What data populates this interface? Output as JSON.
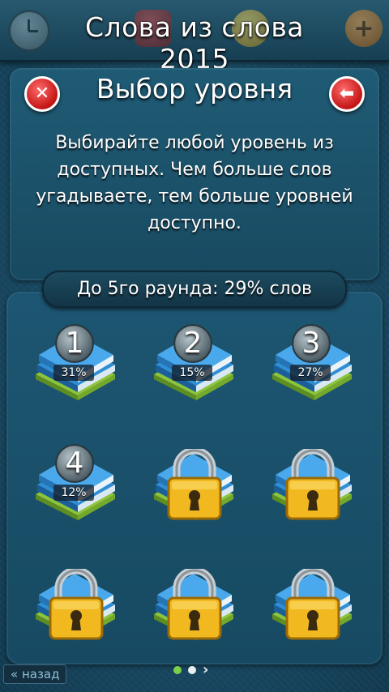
{
  "topbar": {
    "title": "Слова из слова 2015",
    "icons": [
      "clock-icon",
      "gift-icon",
      "coin-icon",
      "plus-icon"
    ]
  },
  "panel": {
    "title": "Выбор уровня",
    "description": "Выбирайте любой уровень из доступных. Чем больше слов угадываете, тем больше уровней доступно.",
    "close_icon": "close-icon",
    "back_icon": "back-arrow-icon"
  },
  "progress": {
    "text": "До 5го раунда: 29% слов"
  },
  "levels": [
    {
      "number": "1",
      "percent": "31%",
      "locked": false
    },
    {
      "number": "2",
      "percent": "15%",
      "locked": false
    },
    {
      "number": "3",
      "percent": "27%",
      "locked": false
    },
    {
      "number": "4",
      "percent": "12%",
      "locked": false
    },
    {
      "number": "",
      "percent": "",
      "locked": true
    },
    {
      "number": "",
      "percent": "",
      "locked": true
    },
    {
      "number": "",
      "percent": "",
      "locked": true
    },
    {
      "number": "",
      "percent": "",
      "locked": true
    },
    {
      "number": "",
      "percent": "",
      "locked": true
    }
  ],
  "pager": {
    "pages": 2,
    "current": 1,
    "next_icon": "chevron-right-icon"
  },
  "footer": {
    "back_label": "« назад"
  },
  "colors": {
    "background": "#1b4f69",
    "close_red": "#c31515",
    "lock_gold": "#f2b81f",
    "active_dot": "#7ad04a"
  }
}
